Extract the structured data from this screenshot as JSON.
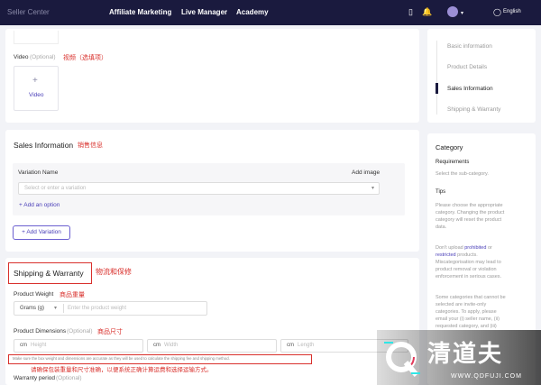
{
  "topbar": {
    "logo": "Seller Center",
    "nav": [
      "Affiliate Marketing",
      "Live Manager",
      "Academy"
    ],
    "language": "English"
  },
  "video": {
    "label": "Video",
    "optional": "(Optional)",
    "annotation": "视频（选填项）",
    "plus": "+",
    "upload_label": "Video"
  },
  "sales": {
    "title": "Sales Information",
    "annotation": "销售信息",
    "variation_name": "Variation Name",
    "add_image": "Add image",
    "placeholder": "Select or enter a variation",
    "add_option": "+ Add an option",
    "add_variation": "+ Add Variation"
  },
  "shipping": {
    "title": "Shipping & Warranty",
    "title_annotation": "物流和保修",
    "weight_label": "Product Weight",
    "weight_annotation": "商品重量",
    "weight_unit": "Grams (g)",
    "weight_placeholder": "Enter the product weight",
    "dims_label": "Product Dimensions",
    "dims_optional": "(Optional)",
    "dims_annotation": "商品尺寸",
    "height_unit": "cm",
    "height_placeholder": "Height",
    "width_unit": "cm",
    "width_placeholder": "Width",
    "length_unit": "cm",
    "length_placeholder": "Length",
    "warning": "Make sure the box weight and dimensions are accurate as they will be used to calculate the shipping fee and shipping method.",
    "warning_annotation": "请确保包装重量和尺寸准确，以便系统正确计算运费和选择运输方式。",
    "warranty_label": "Warranty period",
    "warranty_optional": "(Optional)"
  },
  "sidenav": {
    "items": [
      "Basic information",
      "Product Details",
      "Sales Information",
      "Shipping & Warranty"
    ],
    "active_index": 2
  },
  "category": {
    "title": "Category",
    "requirements": "Requirements",
    "requirements_text": "Select the sub-category.",
    "tips_title": "Tips",
    "tips": [
      "Please choose the appropriate",
      "category. Changing the product",
      "category will reset the product",
      "data."
    ],
    "tips2_a": "Don't upload",
    "tips2_prohibited": "prohibited",
    "tips2_or": "or",
    "tips2_restricted": "restricted",
    "tips2_rest": [
      "products.",
      "Miscategorisation may lead to",
      "product removal or violation",
      "enforcement in serious cases."
    ],
    "tips3": [
      "Some categories that cannot be",
      "selected are invite-only",
      "categories. To apply, please",
      "email your (i) seller name, (ii)",
      "requested category, and (iii)"
    ]
  },
  "watermark": {
    "brand": "清道夫",
    "url": "WWW.QDFUJI.COM"
  },
  "colors": {
    "topbar": "#1a1a3e",
    "accent": "#4a3fb8",
    "annotation_red": "#d9302c"
  }
}
